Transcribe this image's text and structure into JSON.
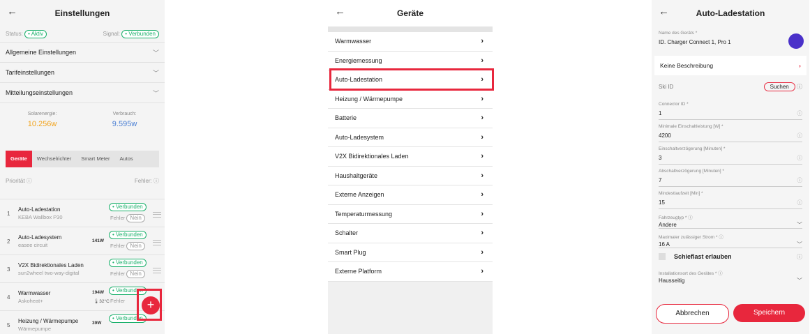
{
  "colors": {
    "accent": "#e8273d",
    "ok": "#1ab06b",
    "solar": "#f2a31b",
    "usage": "#4a7fd4",
    "avatar": "#4a31c9"
  },
  "s1": {
    "title": "Einstellungen",
    "status_label": "Status:",
    "status_value": "• Aktiv",
    "signal_label": "Signal:",
    "signal_value": "• Verbunden",
    "sections": [
      "Allgemeine Einstellungen",
      "Tarifeinstellungen",
      "Mitteilungseinstellungen"
    ],
    "solar_label": "Solarenergie:",
    "solar_value": "10.256w",
    "usage_label": "Verbrauch:",
    "usage_value": "9.595w",
    "tabs": [
      "Geräte",
      "Wechselrichter",
      "Smart Meter",
      "Autos"
    ],
    "priority": "Priorität ⓘ",
    "errors": "Fehler: ⓘ",
    "devices": [
      {
        "num": "1",
        "name": "Auto-Ladestation",
        "sub": "KEBA Wallbox P30",
        "watt": "",
        "temp": "",
        "badge": "• Verbunden",
        "err": "Fehler",
        "no": "Nein"
      },
      {
        "num": "2",
        "name": "Auto-Ladesystem",
        "sub": "easee circuit",
        "watt": "141W",
        "temp": "",
        "badge": "• Verbunden",
        "err": "Fehler",
        "no": "Nein"
      },
      {
        "num": "3",
        "name": "V2X Bidirektionales Laden",
        "sub": "sun2wheel two-way-digital",
        "watt": "",
        "temp": "",
        "badge": "• Verbunden",
        "err": "Fehler",
        "no": "Nein"
      },
      {
        "num": "4",
        "name": "Warmwasser",
        "sub": "Askoheat+",
        "watt": "194W",
        "temp": "32°C",
        "badge": "• Verbunden",
        "err": "Fehler",
        "no": ""
      },
      {
        "num": "5",
        "name": "Heizung / Wärmepumpe",
        "sub": "Wärmepumpe",
        "watt": "39W",
        "temp": "",
        "badge": "• Verbunden",
        "err": "",
        "no": ""
      }
    ],
    "fab": "+"
  },
  "s2": {
    "title": "Geräte",
    "items": [
      "Warmwasser",
      "Energiemessung",
      "Auto-Ladestation",
      "Heizung / Wärmepumpe",
      "Batterie",
      "Auto-Ladesystem",
      "V2X Bidirektionales Laden",
      "Haushaltgeräte",
      "Externe Anzeigen",
      "Temperaturmessung",
      "Schalter",
      "Smart Plug",
      "Externe Platform"
    ]
  },
  "s3": {
    "title": "Auto-Ladestation",
    "name_label": "Name des Geräts *",
    "name_value": "ID. Charger Connect 1, Pro 1",
    "desc": "Keine Beschreibung",
    "ski_label": "Ski ID",
    "ski_button": "Suchen",
    "fields": [
      {
        "label": "Connector ID *",
        "value": "1"
      },
      {
        "label": "Minimale Einschaltleistung [W] *",
        "value": "4200"
      },
      {
        "label": "Einschaltverzögerung [Minuten] *",
        "value": "3"
      },
      {
        "label": "Abschaltverzögerung [Minuten] *",
        "value": "7"
      },
      {
        "label": "Mindestlaufzeit [Min] *",
        "value": "15"
      }
    ],
    "selects": [
      {
        "label": "Fahrzeugtyp * ⓘ",
        "value": "Andere"
      },
      {
        "label": "Maximaler zulässiger Strom * ⓘ",
        "value": "16 A"
      }
    ],
    "checkbox": "Schieflast erlauben",
    "location_label": "Installationsort des Gerätes * ⓘ",
    "location_value": "Hausseitig",
    "cancel": "Abbrechen",
    "save": "Speichern"
  }
}
